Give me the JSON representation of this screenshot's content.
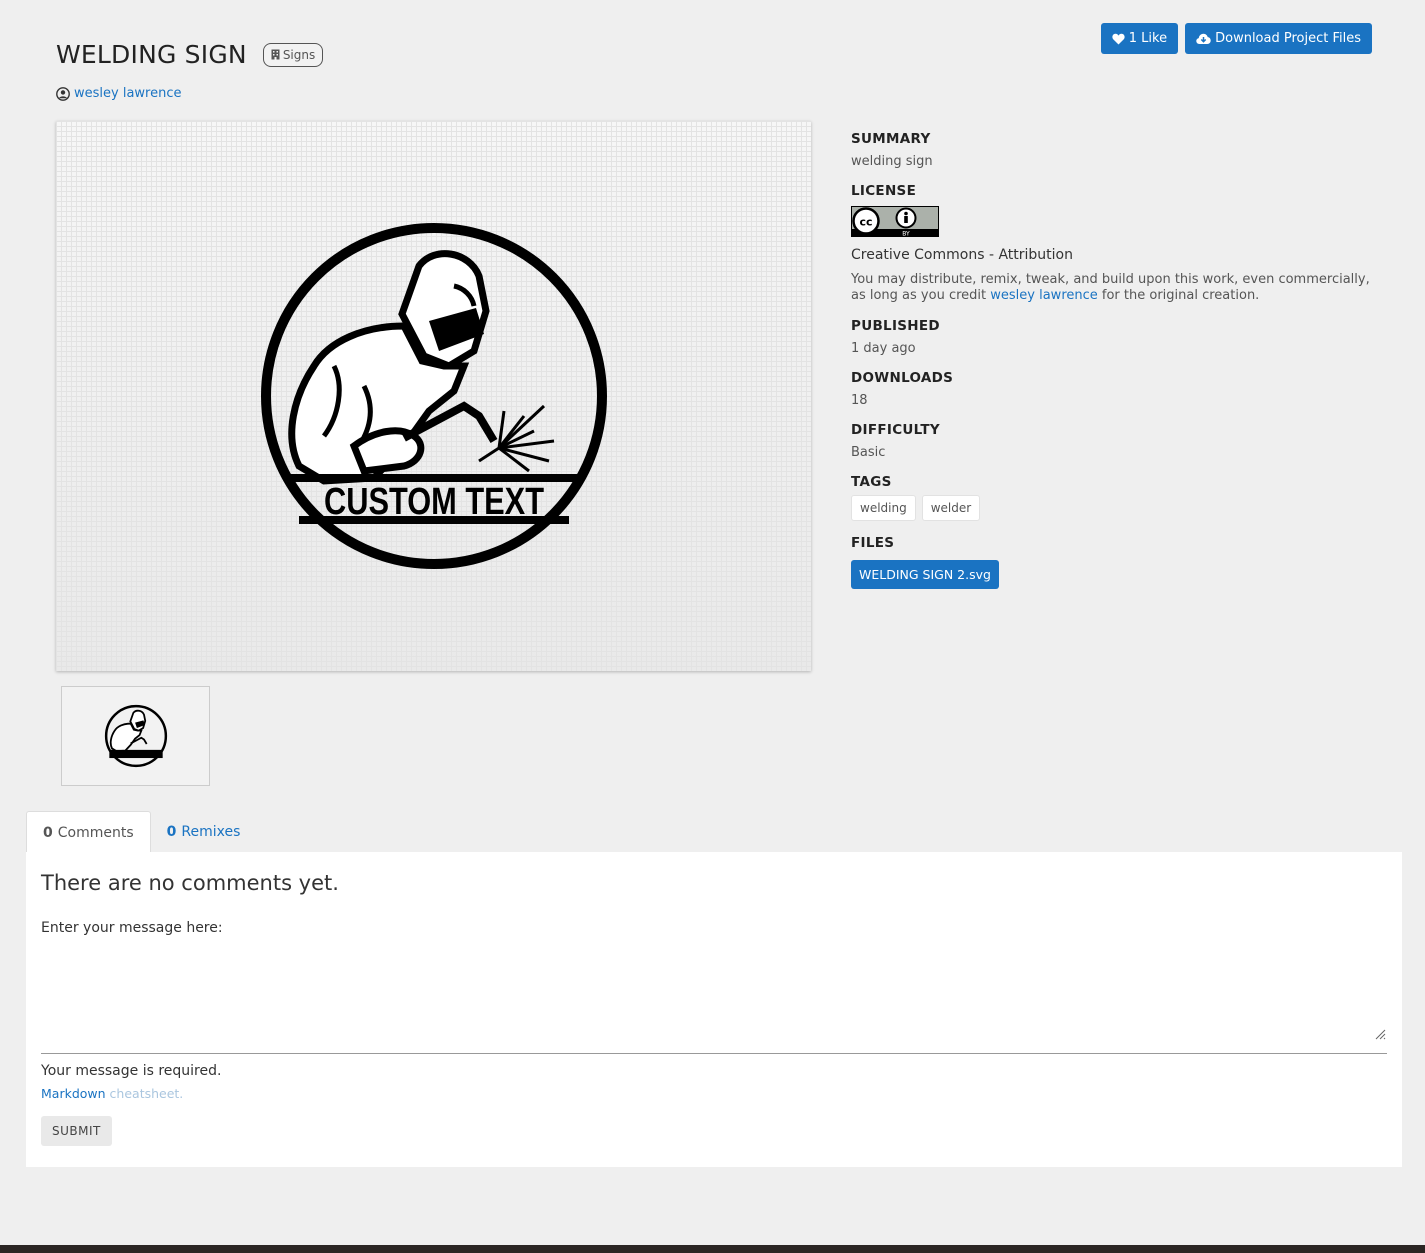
{
  "project": {
    "title": "WELDING SIGN",
    "category": "Signs",
    "author": "wesley lawrence"
  },
  "actions": {
    "like_label": "1 Like",
    "download_label": "Download Project Files"
  },
  "preview": {
    "sign_text": "CUSTOM TEXT"
  },
  "sidebar": {
    "summary": {
      "heading": "SUMMARY",
      "value": "welding sign"
    },
    "license": {
      "heading": "LICENSE",
      "badge_text": "BY",
      "name": "Creative Commons - Attribution",
      "desc_before": "You may distribute, remix, tweak, and build upon this work, even commercially, as long as you credit",
      "desc_link": "wesley lawrence",
      "desc_after": "for the original creation."
    },
    "published": {
      "heading": "PUBLISHED",
      "value": "1 day ago"
    },
    "downloads": {
      "heading": "DOWNLOADS",
      "value": "18"
    },
    "difficulty": {
      "heading": "DIFFICULTY",
      "value": "Basic"
    },
    "tags": {
      "heading": "TAGS",
      "items": [
        "welding",
        "welder"
      ]
    },
    "files": {
      "heading": "FILES",
      "items": [
        "WELDING SIGN 2.svg"
      ]
    }
  },
  "tabs": {
    "comments": {
      "count": "0",
      "label": "Comments"
    },
    "remixes": {
      "count": "0",
      "label": "Remixes"
    }
  },
  "comments": {
    "empty_text": "There are no comments yet.",
    "message_label": "Enter your message here:",
    "message_value": "",
    "required_text": "Your message is required.",
    "markdown_link": "Markdown",
    "cheatsheet_text": "cheatsheet.",
    "submit_label": "SUBMIT"
  },
  "colors": {
    "accent": "#1a73c2",
    "background": "#efefef"
  }
}
